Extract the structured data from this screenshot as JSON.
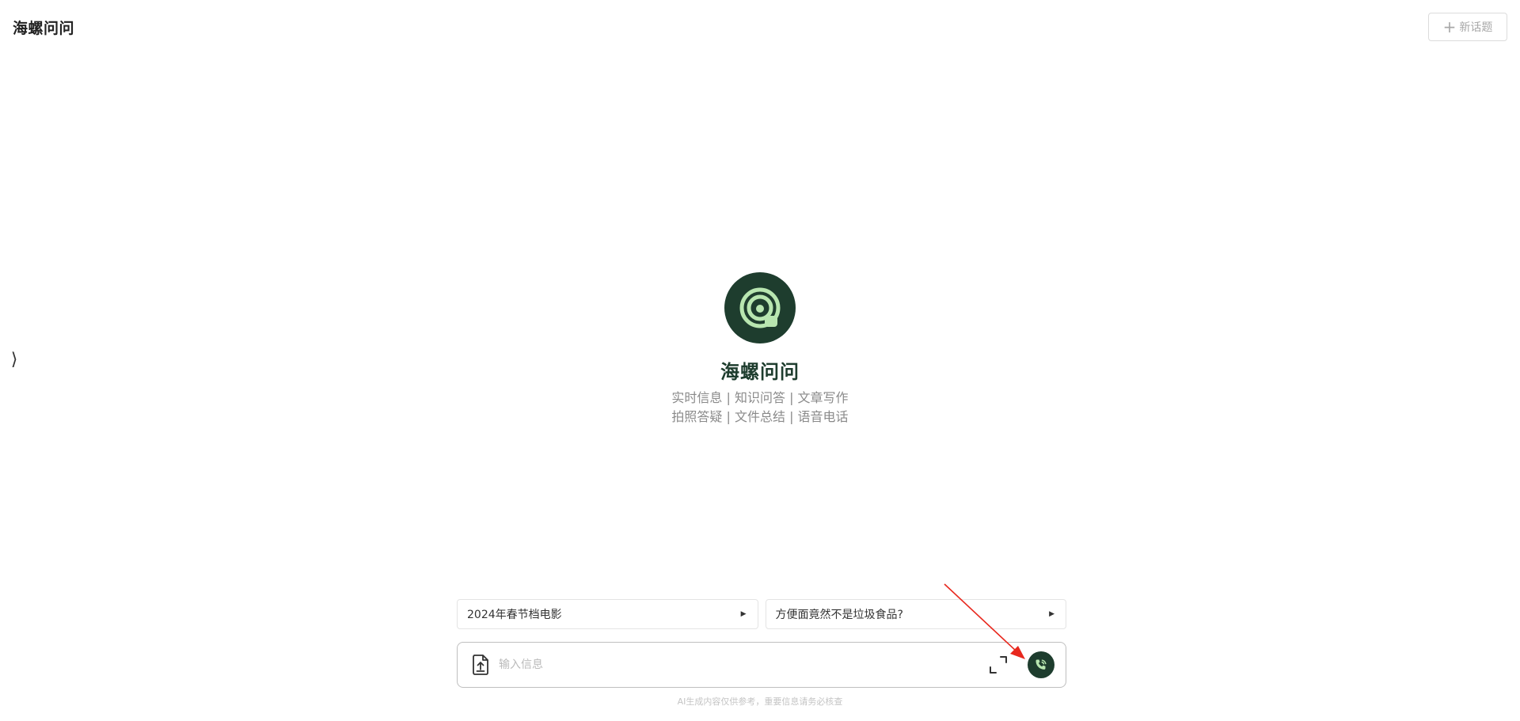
{
  "header": {
    "app_title": "海螺问问",
    "new_topic_label": "新话题",
    "new_topic_icon": "plus-icon"
  },
  "sidebar_toggle": {
    "glyph": "⟩",
    "icon": "chevron-right-icon"
  },
  "hero": {
    "logo_icon": "snail-spiral-icon",
    "title": "海螺问问",
    "features_line1": "实时信息 | 知识问答 | 文章写作",
    "features_line2": "拍照答疑 | 文件总结 | 语音电话"
  },
  "suggestions": [
    {
      "label": "2024年春节档电影",
      "icon": "triangle-right-icon"
    },
    {
      "label": "方便面竟然不是垃圾食品?",
      "icon": "triangle-right-icon"
    }
  ],
  "input_bar": {
    "placeholder": "输入信息",
    "value": "",
    "upload_icon": "upload-file-icon",
    "expand_icon": "expand-icon",
    "call_icon": "phone-call-icon"
  },
  "disclaimer": "AI生成内容仅供参考，重要信息请务必核查",
  "colors": {
    "brand_dark": "#1e3d2e",
    "brand_light": "#b8e6b0",
    "annotation_red": "#e8281e"
  }
}
